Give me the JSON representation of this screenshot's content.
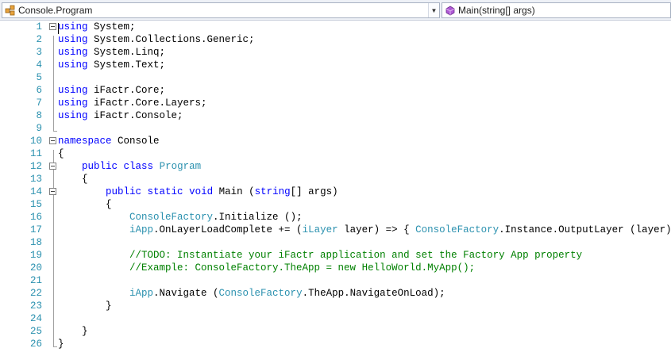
{
  "nav": {
    "type_combo": "Console.Program",
    "member_combo": "Main(string[] args)"
  },
  "icons": {
    "type_icon": "class-icon",
    "member_icon": "method-icon",
    "dropdown": "chevron-down-icon"
  },
  "colors": {
    "keyword": "#0000ff",
    "type": "#2b91af",
    "comment": "#008000",
    "line_number": "#2b91af"
  },
  "lines": [
    {
      "num": "1",
      "fold": true,
      "tokens": [
        {
          "t": "kw",
          "v": "using"
        },
        {
          "t": "tx",
          "v": " System;"
        }
      ]
    },
    {
      "num": "2",
      "fold": false,
      "tokens": [
        {
          "t": "kw",
          "v": "using"
        },
        {
          "t": "tx",
          "v": " System.Collections.Generic;"
        }
      ]
    },
    {
      "num": "3",
      "fold": false,
      "tokens": [
        {
          "t": "kw",
          "v": "using"
        },
        {
          "t": "tx",
          "v": " System.Linq;"
        }
      ]
    },
    {
      "num": "4",
      "fold": false,
      "tokens": [
        {
          "t": "kw",
          "v": "using"
        },
        {
          "t": "tx",
          "v": " System.Text;"
        }
      ]
    },
    {
      "num": "5",
      "fold": false,
      "tokens": []
    },
    {
      "num": "6",
      "fold": false,
      "tokens": [
        {
          "t": "kw",
          "v": "using"
        },
        {
          "t": "tx",
          "v": " iFactr.Core;"
        }
      ]
    },
    {
      "num": "7",
      "fold": false,
      "tokens": [
        {
          "t": "kw",
          "v": "using"
        },
        {
          "t": "tx",
          "v": " iFactr.Core.Layers;"
        }
      ]
    },
    {
      "num": "8",
      "fold": false,
      "tokens": [
        {
          "t": "kw",
          "v": "using"
        },
        {
          "t": "tx",
          "v": " iFactr.Console;"
        }
      ]
    },
    {
      "num": "9",
      "fold": false,
      "tokens": []
    },
    {
      "num": "10",
      "fold": true,
      "tokens": [
        {
          "t": "kw",
          "v": "namespace"
        },
        {
          "t": "tx",
          "v": " Console"
        }
      ]
    },
    {
      "num": "11",
      "fold": false,
      "tokens": [
        {
          "t": "tx",
          "v": "{"
        }
      ]
    },
    {
      "num": "12",
      "fold": true,
      "tokens": [
        {
          "t": "tx",
          "v": "    "
        },
        {
          "t": "kw",
          "v": "public"
        },
        {
          "t": "tx",
          "v": " "
        },
        {
          "t": "kw",
          "v": "class"
        },
        {
          "t": "tx",
          "v": " "
        },
        {
          "t": "ty",
          "v": "Program"
        }
      ]
    },
    {
      "num": "13",
      "fold": false,
      "tokens": [
        {
          "t": "tx",
          "v": "    {"
        }
      ]
    },
    {
      "num": "14",
      "fold": true,
      "tokens": [
        {
          "t": "tx",
          "v": "        "
        },
        {
          "t": "kw",
          "v": "public"
        },
        {
          "t": "tx",
          "v": " "
        },
        {
          "t": "kw",
          "v": "static"
        },
        {
          "t": "tx",
          "v": " "
        },
        {
          "t": "kw",
          "v": "void"
        },
        {
          "t": "tx",
          "v": " Main ("
        },
        {
          "t": "kw",
          "v": "string"
        },
        {
          "t": "tx",
          "v": "[] args)"
        }
      ]
    },
    {
      "num": "15",
      "fold": false,
      "tokens": [
        {
          "t": "tx",
          "v": "        {"
        }
      ]
    },
    {
      "num": "16",
      "fold": false,
      "tokens": [
        {
          "t": "tx",
          "v": "            "
        },
        {
          "t": "ty",
          "v": "ConsoleFactory"
        },
        {
          "t": "tx",
          "v": ".Initialize ();"
        }
      ]
    },
    {
      "num": "17",
      "fold": false,
      "tokens": [
        {
          "t": "tx",
          "v": "            "
        },
        {
          "t": "ty",
          "v": "iApp"
        },
        {
          "t": "tx",
          "v": ".OnLayerLoadComplete += ("
        },
        {
          "t": "ty",
          "v": "iLayer"
        },
        {
          "t": "tx",
          "v": " layer) => { "
        },
        {
          "t": "ty",
          "v": "ConsoleFactory"
        },
        {
          "t": "tx",
          "v": ".Instance.OutputLayer (layer); };"
        }
      ]
    },
    {
      "num": "18",
      "fold": false,
      "tokens": []
    },
    {
      "num": "19",
      "fold": false,
      "tokens": [
        {
          "t": "tx",
          "v": "            "
        },
        {
          "t": "cm",
          "v": "//TODO: Instantiate your iFactr application and set the Factory App property"
        }
      ]
    },
    {
      "num": "20",
      "fold": false,
      "tokens": [
        {
          "t": "tx",
          "v": "            "
        },
        {
          "t": "cm",
          "v": "//Example: ConsoleFactory.TheApp = new HelloWorld.MyApp();"
        }
      ]
    },
    {
      "num": "21",
      "fold": false,
      "tokens": []
    },
    {
      "num": "22",
      "fold": false,
      "tokens": [
        {
          "t": "tx",
          "v": "            "
        },
        {
          "t": "ty",
          "v": "iApp"
        },
        {
          "t": "tx",
          "v": ".Navigate ("
        },
        {
          "t": "ty",
          "v": "ConsoleFactory"
        },
        {
          "t": "tx",
          "v": ".TheApp.NavigateOnLoad);"
        }
      ]
    },
    {
      "num": "23",
      "fold": false,
      "tokens": [
        {
          "t": "tx",
          "v": "        }"
        }
      ]
    },
    {
      "num": "24",
      "fold": false,
      "tokens": []
    },
    {
      "num": "25",
      "fold": false,
      "tokens": [
        {
          "t": "tx",
          "v": "    }"
        }
      ]
    },
    {
      "num": "26",
      "fold": false,
      "tokens": [
        {
          "t": "tx",
          "v": "}"
        }
      ]
    }
  ]
}
